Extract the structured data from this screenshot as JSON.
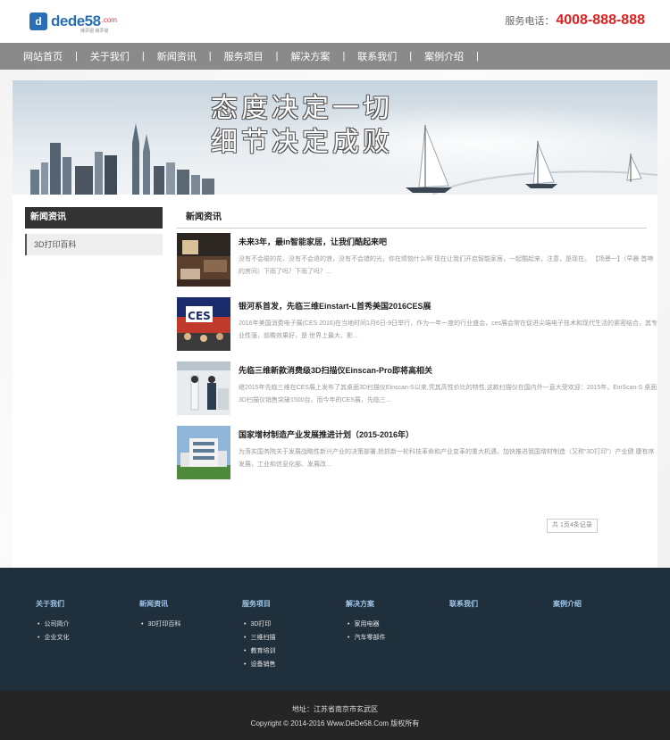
{
  "header": {
    "logo_text": "dede58",
    "logo_com": ".com",
    "logo_sub": "織夢園 織夢貓",
    "phone_label": "服务电话：",
    "phone_number": "4008-888-888"
  },
  "nav": {
    "items": [
      "网站首页",
      "关于我们",
      "新闻资讯",
      "服务项目",
      "解决方案",
      "联系我们",
      "案例介绍"
    ]
  },
  "banner": {
    "line1": "态度决定一切",
    "line2": "细节决定成败"
  },
  "sidebar": {
    "title": "新闻资讯",
    "items": [
      "3D打印百科"
    ]
  },
  "main": {
    "title": "新闻资讯",
    "news": [
      {
        "title": "未来3年，最in智能家居，让我们酷起来吧",
        "desc": "没有不会碰的花，没有不会退的浪，没有不会错的光，你在烦恼什么啊 现在让我们开启智能家居，一起酷起来，注意，是现在。 【场景一】（早晨 首啼的房间）下雨了吗？下雨了吗？..."
      },
      {
        "title": "银河系首发，先临三维Einstart-L首秀美国2016CES展",
        "desc": "2016年美国消费电子展(CES 2016)在当地时间1月6日-9日举行，作为一年一度的行业盛会，ces展会常在促进尖端电子技术和现代生活的紧密结合，其专业性强，前瞻效果好，是 世界上最大、影..."
      },
      {
        "title": "先临三维新款消费级3D扫描仪Einscan-Pro即将高相关",
        "desc": "继2015年先临三维在CES展上发布了其桌面3D扫描仪Einscan-S以来,凭其高性价比的特性,这款扫描仪在国内外一直大受欢迎：2015年，EinScan-S 桌面3D扫描仪销售突破1500台。而今年的CES展，先临三..."
      },
      {
        "title": "国家增材制造产业发展推进计划（2015-2016年）",
        "desc": "为落实国务院关于发展战略性新兴产业的决策部署,抢抓新一轮科技革命和产业变革的重大机遇，加快推进我国增材制造（又称“3D打印”）产业健 康有序发展，工业和信息化部、发展改..."
      }
    ],
    "pager": "共 1页4条记录"
  },
  "footer": {
    "columns": [
      {
        "title": "关于我们",
        "items": [
          "公司简介",
          "企业文化"
        ]
      },
      {
        "title": "新闻资讯",
        "items": [
          "3D打印百科"
        ]
      },
      {
        "title": "服务项目",
        "items": [
          "3D打印",
          "三维扫描",
          "教育培训",
          "设备销售"
        ]
      },
      {
        "title": "解决方案",
        "items": [
          "家用电器",
          "汽车零部件"
        ]
      },
      {
        "title": "联系我们",
        "items": []
      },
      {
        "title": "案例介绍",
        "items": []
      }
    ],
    "address": "地址：江苏省南京市玄武区",
    "copyright": "Copyright © 2014-2016 Www.DeDe58.Com 版权所有"
  },
  "colors": {
    "phone": "#e02020",
    "nav_bg": "#8a8a8a",
    "footer_bg": "#1f2f3c",
    "footer_title": "#9fc6e8",
    "bottom_bg": "#252525",
    "logo": "#2a6eb5"
  }
}
